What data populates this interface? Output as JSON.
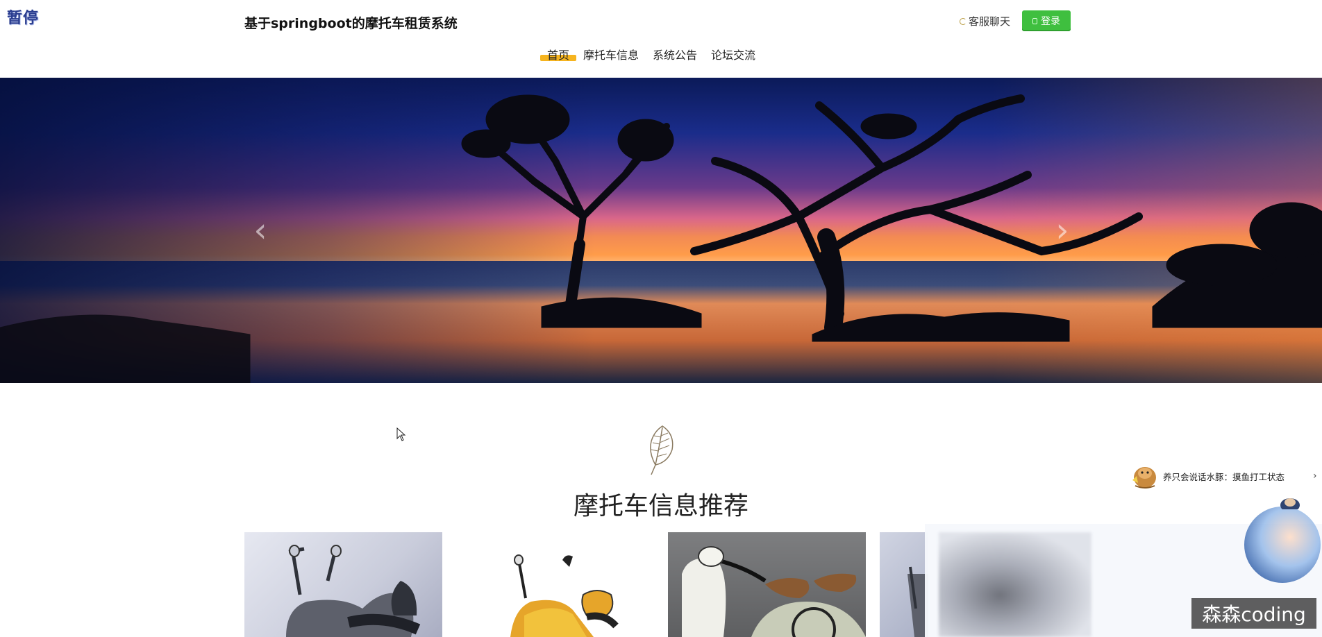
{
  "overlay": {
    "pause_label": "暂停"
  },
  "header": {
    "title": "基于springboot的摩托车租赁系统",
    "chat_label": "客服聊天",
    "login_label": "登录"
  },
  "nav": {
    "items": [
      {
        "label": "首页",
        "active": true
      },
      {
        "label": "摩托车信息",
        "active": false
      },
      {
        "label": "系统公告",
        "active": false
      },
      {
        "label": "论坛交流",
        "active": false
      }
    ]
  },
  "banner": {
    "prev_icon": "chevron-left-icon",
    "next_icon": "chevron-right-icon"
  },
  "section": {
    "title": "摩托车信息推荐",
    "icon": "leaf-icon"
  },
  "notice": {
    "text": "养只会说话水豚：摸鱼打工状态",
    "chevron": "›"
  },
  "watermark": {
    "text": "森森coding"
  },
  "colors": {
    "accent": "#f6b41f",
    "login": "#3fbf3f",
    "pause": "#2a3d8f"
  }
}
